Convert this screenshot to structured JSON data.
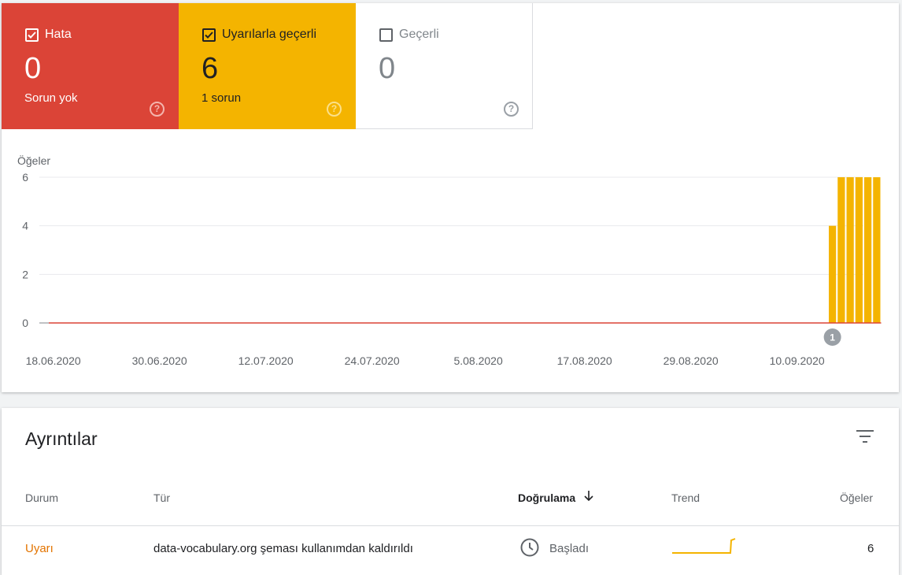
{
  "summary_tiles": [
    {
      "label": "Hata",
      "value": "0",
      "subtitle": "Sorun yok",
      "checked": true,
      "color": "#db4437",
      "help_icon": "help-circle-icon"
    },
    {
      "label": "Uyarılarla geçerli",
      "value": "6",
      "subtitle": "1 sorun",
      "checked": true,
      "color": "#f4b400",
      "help_icon": "help-circle-icon"
    },
    {
      "label": "Geçerli",
      "value": "0",
      "subtitle": "",
      "checked": false,
      "color": "#ffffff",
      "help_icon": "help-circle-icon"
    }
  ],
  "chart_data": {
    "type": "bar",
    "ylabel": "Öğeler",
    "ylim": [
      0,
      6
    ],
    "yticks": [
      "0",
      "2",
      "4",
      "6"
    ],
    "xticks": [
      "18.06.2020",
      "30.06.2020",
      "12.07.2020",
      "24.07.2020",
      "5.08.2020",
      "17.08.2020",
      "29.08.2020",
      "10.09.2020"
    ],
    "series": [
      {
        "color": "#f4b400",
        "start": "2020-06-18",
        "values": [
          0,
          0,
          0,
          0,
          0,
          0,
          0,
          0,
          0,
          0,
          0,
          0,
          0,
          0,
          0,
          0,
          0,
          0,
          0,
          0,
          0,
          0,
          0,
          0,
          0,
          0,
          0,
          0,
          0,
          0,
          0,
          0,
          0,
          0,
          0,
          0,
          0,
          0,
          0,
          0,
          0,
          0,
          0,
          0,
          0,
          0,
          0,
          0,
          0,
          0,
          0,
          0,
          0,
          0,
          0,
          0,
          0,
          0,
          0,
          0,
          0,
          0,
          0,
          0,
          0,
          0,
          0,
          0,
          0,
          0,
          0,
          0,
          0,
          0,
          0,
          0,
          0,
          0,
          0,
          0,
          0,
          0,
          0,
          0,
          0,
          0,
          0,
          0,
          4,
          6,
          6,
          6,
          6,
          6
        ]
      },
      {
        "color": "#db4437",
        "start": "2020-06-18",
        "values": [
          0,
          0,
          0,
          0,
          0,
          0,
          0,
          0,
          0,
          0,
          0,
          0,
          0,
          0,
          0,
          0,
          0,
          0,
          0,
          0,
          0,
          0,
          0,
          0,
          0,
          0,
          0,
          0,
          0,
          0,
          0,
          0,
          0,
          0,
          0,
          0,
          0,
          0,
          0,
          0,
          0,
          0,
          0,
          0,
          0,
          0,
          0,
          0,
          0,
          0,
          0,
          0,
          0,
          0,
          0,
          0,
          0,
          0,
          0,
          0,
          0,
          0,
          0,
          0,
          0,
          0,
          0,
          0,
          0,
          0,
          0,
          0,
          0,
          0,
          0,
          0,
          0,
          0,
          0,
          0,
          0,
          0,
          0,
          0,
          0,
          0,
          0,
          0,
          0,
          0,
          0,
          0,
          0,
          0
        ]
      }
    ],
    "annotation": {
      "label": "1",
      "date": "2020-09-14"
    },
    "grid": true
  },
  "details": {
    "title": "Ayrıntılar",
    "filter_icon": "filter-icon",
    "columns": {
      "status": "Durum",
      "type": "Tür",
      "validation": "Doğrulama",
      "trend": "Trend",
      "items": "Öğeler"
    },
    "sort_icon": "arrow-down-icon",
    "rows": [
      {
        "status": "Uyarı",
        "type": "data-vocabulary.org şeması kullanımdan kaldırıldı",
        "validation": "Başladı",
        "validation_icon": "clock-icon",
        "items": "6",
        "trend_color": "#f4b400"
      }
    ]
  }
}
